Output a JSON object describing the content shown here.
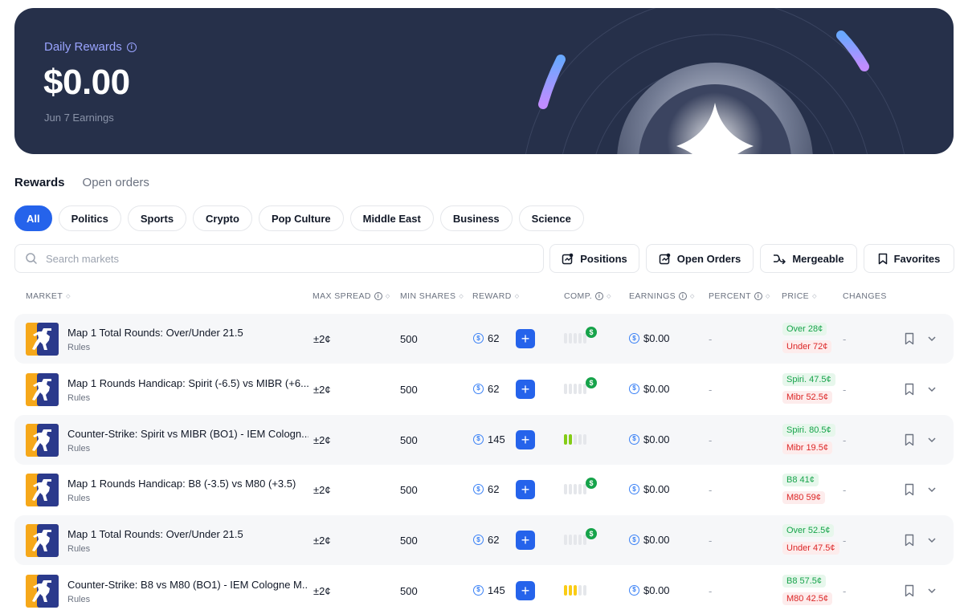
{
  "hero": {
    "label": "Daily Rewards",
    "amount": "$0.00",
    "subtitle": "Jun 7 Earnings"
  },
  "tabs": [
    {
      "label": "Rewards",
      "active": true
    },
    {
      "label": "Open orders",
      "active": false
    }
  ],
  "categories": [
    {
      "label": "All",
      "active": true
    },
    {
      "label": "Politics"
    },
    {
      "label": "Sports"
    },
    {
      "label": "Crypto"
    },
    {
      "label": "Pop Culture"
    },
    {
      "label": "Middle East"
    },
    {
      "label": "Business"
    },
    {
      "label": "Science"
    }
  ],
  "search": {
    "placeholder": "Search markets",
    "value": ""
  },
  "actions": {
    "positions": "Positions",
    "open_orders": "Open Orders",
    "mergeable": "Mergeable",
    "favorites": "Favorites"
  },
  "columns": {
    "market": "MARKET",
    "max_spread": "MAX SPREAD",
    "min_shares": "MIN SHARES",
    "reward": "REWARD",
    "comp": "COMP.",
    "earnings": "EARNINGS",
    "percent": "PERCENT",
    "price": "PRICE",
    "changes": "CHANGES"
  },
  "rows": [
    {
      "name": "Map 1 Total Rounds: Over/Under 21.5",
      "rules": "Rules",
      "spread": "±2¢",
      "shares": "500",
      "reward": "62",
      "comp_level": 0,
      "comp_color": "none",
      "comp_badge": true,
      "earnings": "$0.00",
      "percent": "-",
      "price_up": "Over 28¢",
      "price_down": "Under 72¢",
      "changes": "-"
    },
    {
      "name": "Map 1 Rounds Handicap: Spirit (-6.5) vs MIBR (+6...",
      "rules": "Rules",
      "spread": "±2¢",
      "shares": "500",
      "reward": "62",
      "comp_level": 0,
      "comp_color": "none",
      "comp_badge": true,
      "earnings": "$0.00",
      "percent": "-",
      "price_up": "Spiri. 47.5¢",
      "price_down": "Mibr 52.5¢",
      "changes": "-"
    },
    {
      "name": "Counter-Strike: Spirit vs MIBR (BO1) - IEM Cologn...",
      "rules": "Rules",
      "spread": "±2¢",
      "shares": "500",
      "reward": "145",
      "comp_level": 2,
      "comp_color": "green",
      "comp_badge": false,
      "earnings": "$0.00",
      "percent": "-",
      "price_up": "Spiri. 80.5¢",
      "price_down": "Mibr 19.5¢",
      "changes": "-"
    },
    {
      "name": "Map 1 Rounds Handicap: B8 (-3.5) vs M80 (+3.5)",
      "rules": "Rules",
      "spread": "±2¢",
      "shares": "500",
      "reward": "62",
      "comp_level": 0,
      "comp_color": "none",
      "comp_badge": true,
      "earnings": "$0.00",
      "percent": "-",
      "price_up": "B8 41¢",
      "price_down": "M80 59¢",
      "changes": "-"
    },
    {
      "name": "Map 1 Total Rounds: Over/Under 21.5",
      "rules": "Rules",
      "spread": "±2¢",
      "shares": "500",
      "reward": "62",
      "comp_level": 0,
      "comp_color": "none",
      "comp_badge": true,
      "earnings": "$0.00",
      "percent": "-",
      "price_up": "Over 52.5¢",
      "price_down": "Under 47.5¢",
      "changes": "-"
    },
    {
      "name": "Counter-Strike: B8 vs M80 (BO1) - IEM Cologne M...",
      "rules": "Rules",
      "spread": "±2¢",
      "shares": "500",
      "reward": "145",
      "comp_level": 3,
      "comp_color": "yellow",
      "comp_badge": false,
      "earnings": "$0.00",
      "percent": "-",
      "price_up": "B8 57.5¢",
      "price_down": "M80 42.5¢",
      "changes": "-"
    }
  ]
}
